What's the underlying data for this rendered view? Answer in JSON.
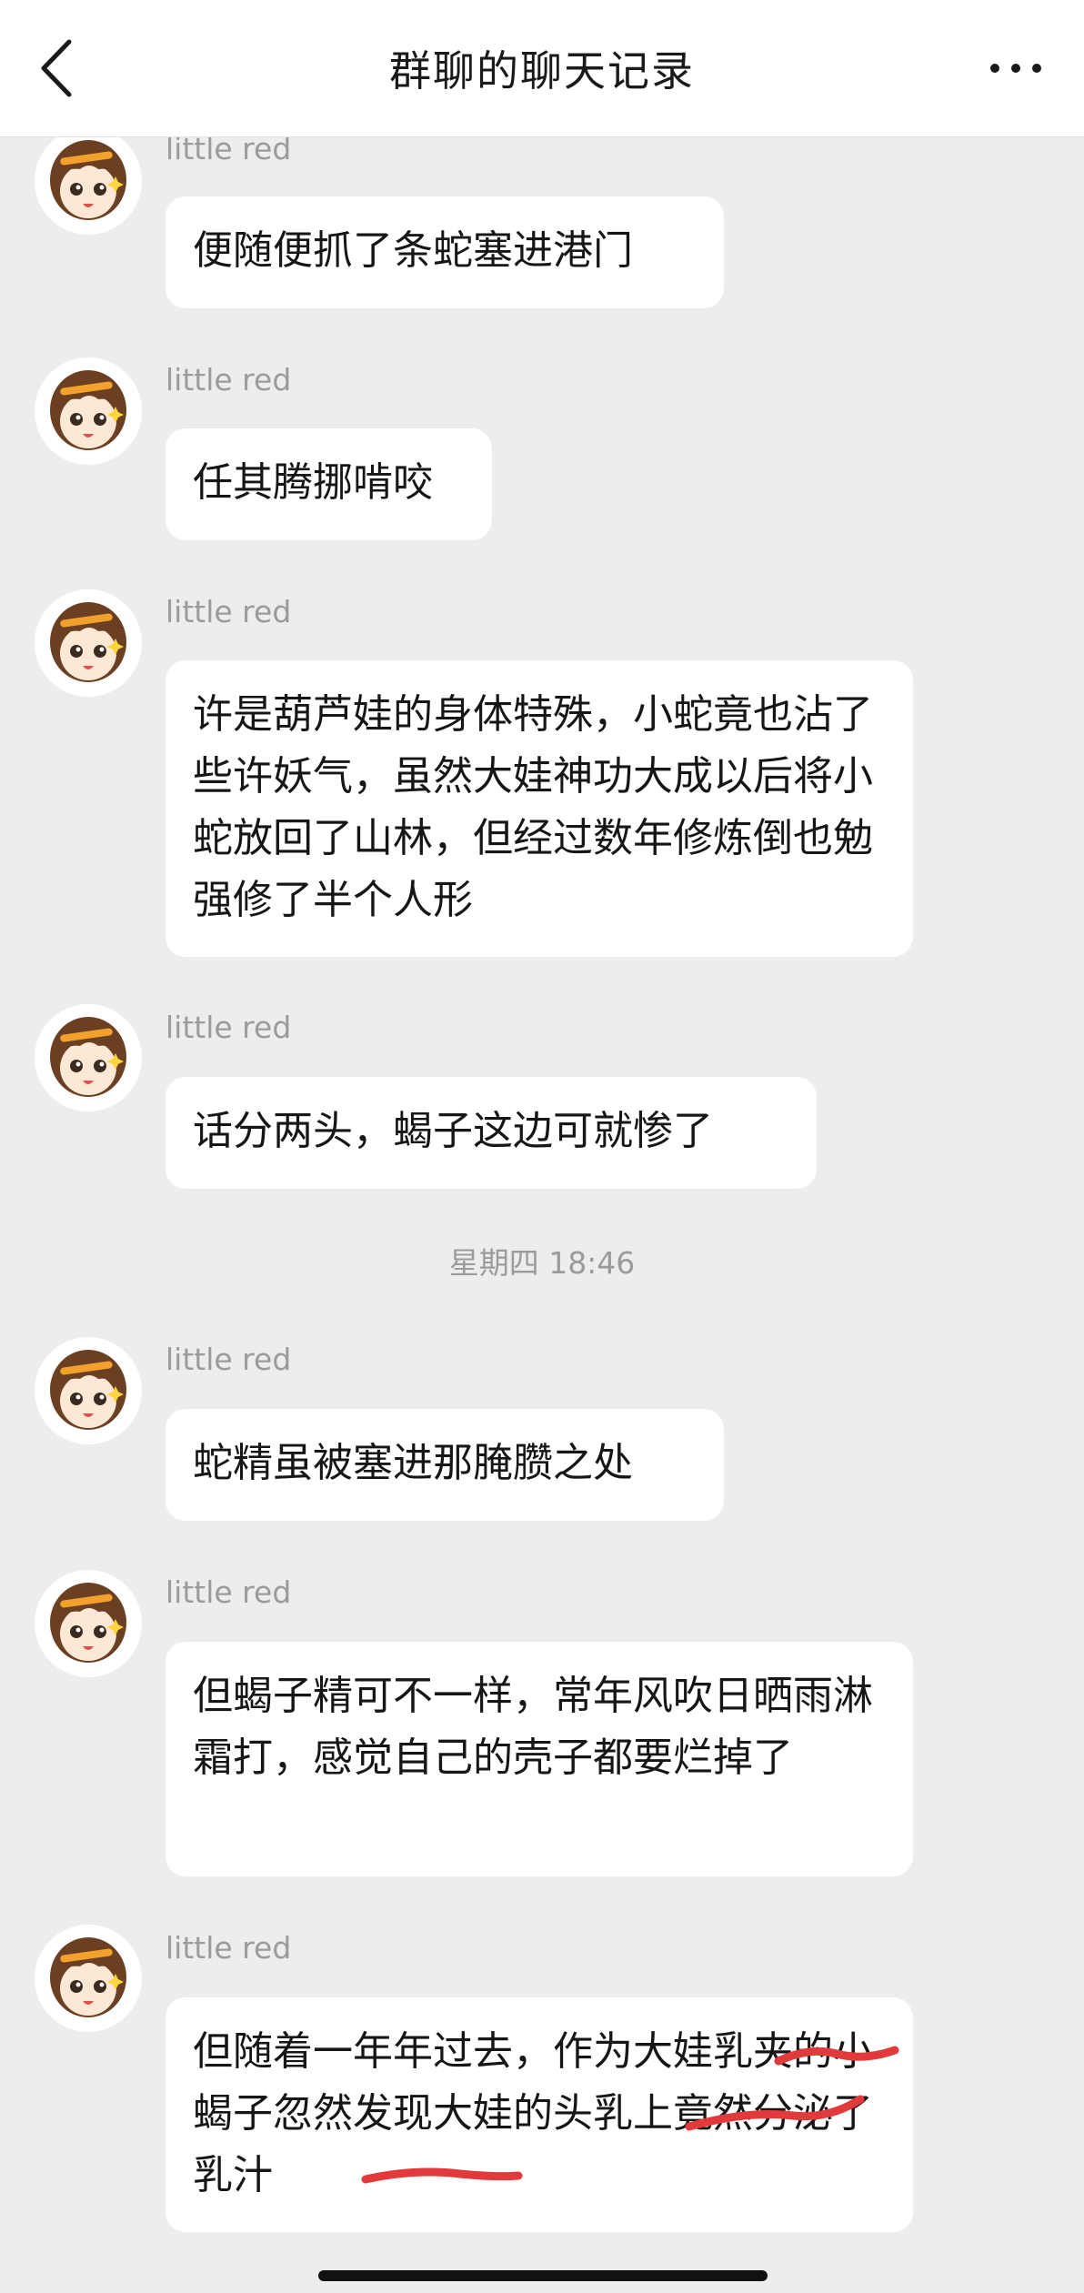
{
  "header": {
    "back_icon": "chevron-left-icon",
    "title": "群聊的聊天记录",
    "more_icon": "more-horizontal-icon"
  },
  "avatar_icon": "anime-girl-avatar-icon",
  "messages": [
    {
      "sender": "little red",
      "text": "便随便抓了条蛇塞进港门"
    },
    {
      "sender": "little red",
      "text": "任其腾挪啃咬"
    },
    {
      "sender": "little red",
      "text": "许是葫芦娃的身体特殊，小蛇竟也沾了些许妖气，虽然大娃神功大成以后将小蛇放回了山林，但经过数年修炼倒也勉强修了半个人形"
    },
    {
      "sender": "little red",
      "text": "话分两头，蝎子这边可就惨了"
    },
    {
      "sender": "little red",
      "text": "蛇精虽被塞进那腌臜之处"
    },
    {
      "sender": "little red",
      "text": "但蝎子精可不一样，常年风吹日晒雨淋霜打，感觉自己的壳子都要烂掉了"
    },
    {
      "sender": "little red",
      "text": "但随着一年年过去，作为大娃乳夹的小蝎子忽然发现大娃的头乳上竟然分泌了乳汁"
    }
  ],
  "time_divider": "星期四 18:46",
  "redaction_color": "#e23a3a"
}
